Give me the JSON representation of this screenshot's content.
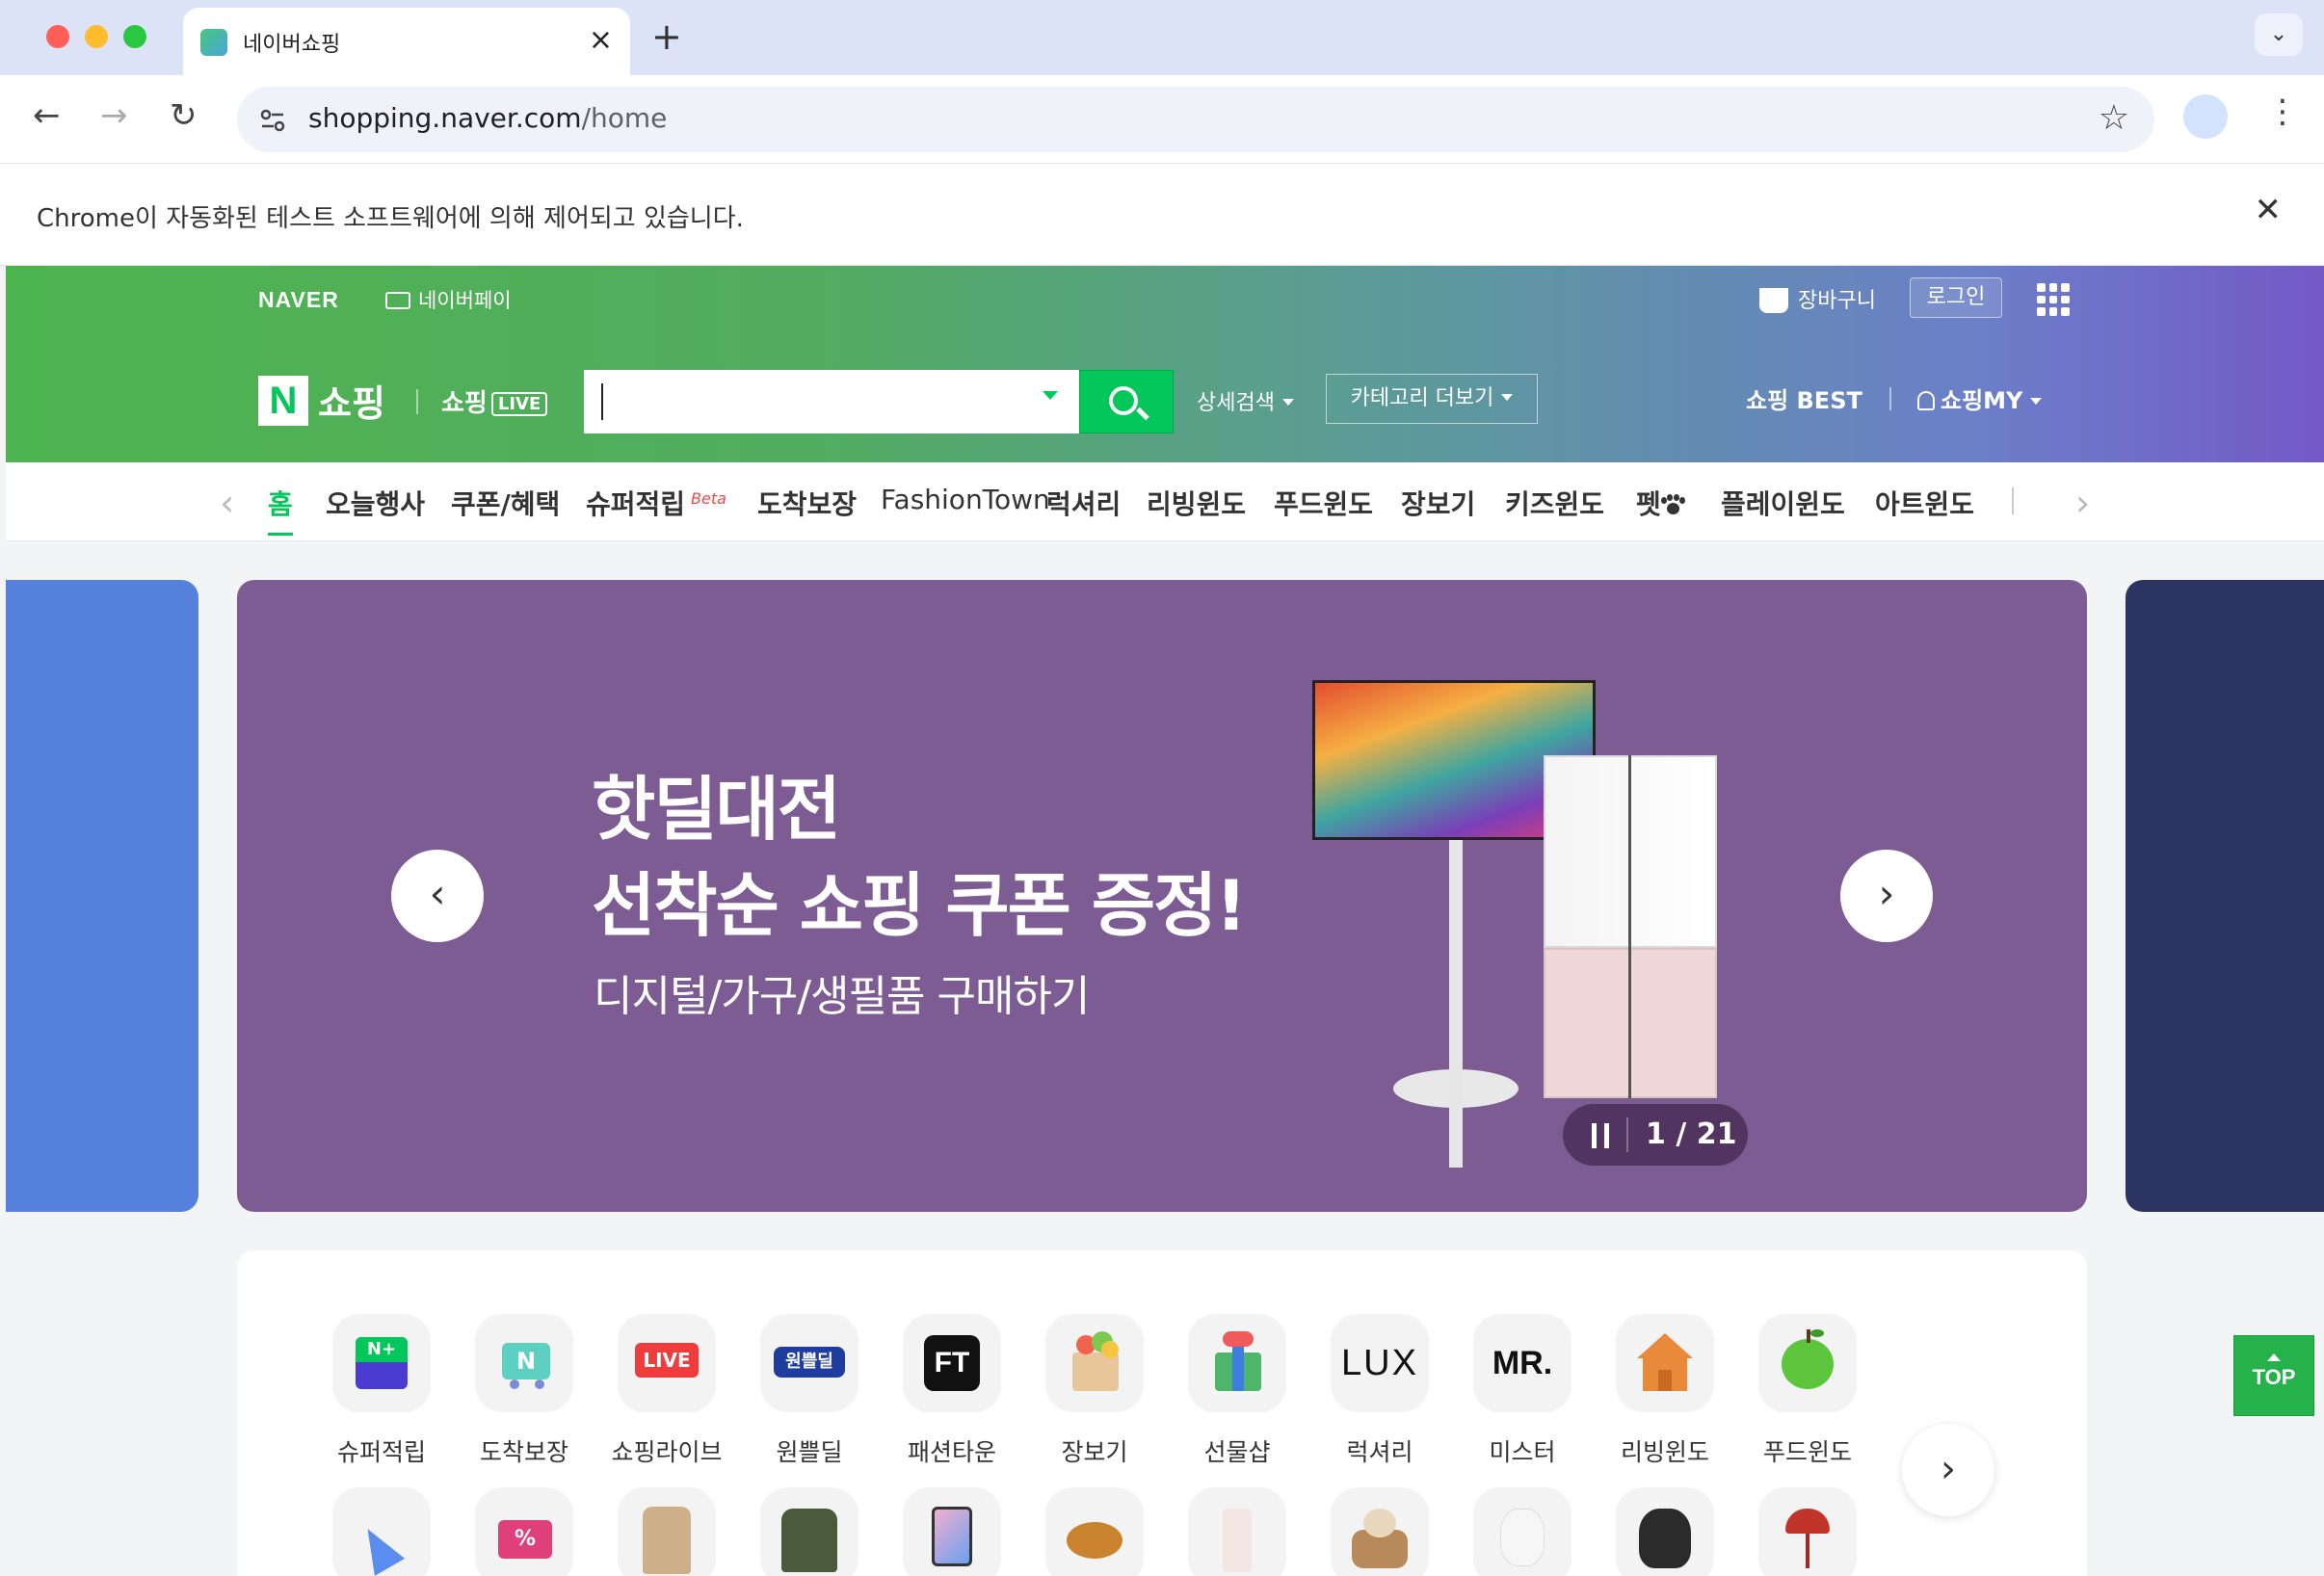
{
  "browser": {
    "tab_title": "네이버쇼핑",
    "new_tab": "+",
    "url_host": "shopping.naver.com",
    "url_path": "/home",
    "infobar_text": "Chrome이 자동화된 테스트 소프트웨어에 의해 제어되고 있습니다.",
    "traffic_colors": [
      "#ff5f57",
      "#febc2e",
      "#28c840"
    ]
  },
  "gnb": {
    "naver": "NAVER",
    "pay": "네이버페이",
    "cart": "장바구니",
    "login": "로그인"
  },
  "header": {
    "logo_n": "N",
    "logo_text": "쇼핑",
    "live_text": "쇼핑",
    "live_badge": "LIVE",
    "search_placeholder": "",
    "detail_search": "상세검색",
    "category_more": "카테고리 더보기",
    "best": "쇼핑 BEST",
    "my": "쇼핑MY"
  },
  "catnav": {
    "items": [
      "홈",
      "오늘행사",
      "쿠폰/혜택",
      "슈퍼적립",
      "도착보장",
      "FashionTown",
      "럭셔리",
      "리빙윈도",
      "푸드윈도",
      "장보기",
      "키즈윈도",
      "펫",
      "플레이윈도",
      "아트윈도"
    ],
    "beta": "Beta"
  },
  "banner": {
    "title_line1": "핫딜대전",
    "title_line2": "선착순 쇼핑 쿠폰 증정!",
    "subtitle": "디지털/가구/생필품 구매하기",
    "counter": "1 / 21",
    "current_slide": 1,
    "total_slides": 21,
    "bg_color": "#7c5c93"
  },
  "shortcuts": {
    "row1": [
      "슈퍼적립",
      "도착보장",
      "쇼핑라이브",
      "원쁠딜",
      "패션타운",
      "장보기",
      "선물샵",
      "럭셔리",
      "미스터",
      "리빙윈도",
      "푸드윈도"
    ],
    "icon_texts": {
      "live": "LIVE",
      "ft": "FT",
      "lux": "LUX",
      "mr": "MR.",
      "onepl": "원쁠딜"
    }
  },
  "top_button": "TOP",
  "colors": {
    "brand_green": "#03c75a"
  }
}
